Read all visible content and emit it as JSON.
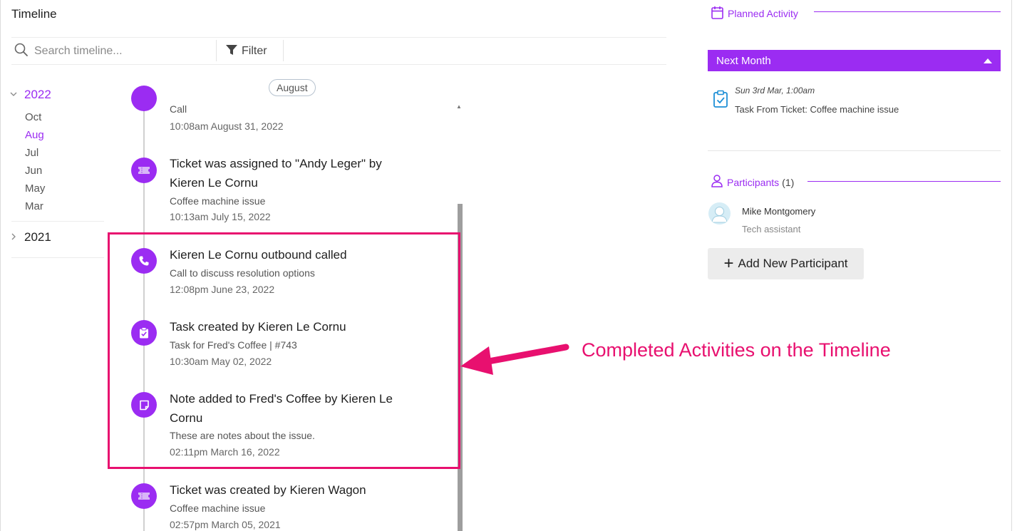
{
  "timeline": {
    "title": "Timeline",
    "search_placeholder": "Search timeline...",
    "filter_label": "Filter",
    "month_pill": "August",
    "years": [
      {
        "label": "2022",
        "expanded": true,
        "months": [
          "Oct",
          "Aug",
          "Jul",
          "Jun",
          "May",
          "Mar"
        ],
        "active_month": "Aug"
      },
      {
        "label": "2021",
        "expanded": false
      }
    ],
    "events": [
      {
        "icon": "phone-icon",
        "title": "",
        "subtitle": "Call",
        "time": "10:08am August 31, 2022"
      },
      {
        "icon": "ticket-icon",
        "title": "Ticket was assigned to \"Andy Leger\" by Kieren Le Cornu",
        "subtitle": "Coffee machine issue",
        "time": "10:13am July 15, 2022"
      },
      {
        "icon": "phone-icon",
        "title": "Kieren Le Cornu outbound called",
        "subtitle": "Call to discuss resolution options",
        "time": "12:08pm June 23, 2022"
      },
      {
        "icon": "task-icon",
        "title": "Task created by Kieren Le Cornu",
        "subtitle": "Task for Fred's Coffee | #743",
        "time": "10:30am May 02, 2022"
      },
      {
        "icon": "note-icon",
        "title": "Note added to Fred's Coffee by Kieren Le Cornu",
        "subtitle": "These are notes about the issue.",
        "time": "02:11pm March 16, 2022"
      },
      {
        "icon": "ticket-icon",
        "title": "Ticket was created by Kieren Wagon",
        "subtitle": "Coffee machine issue",
        "time": "02:57pm March 05, 2021"
      }
    ]
  },
  "annotation": {
    "text": "Completed Activities on the Timeline",
    "color": "#e8106f"
  },
  "planned_activity": {
    "heading": "Planned Activity",
    "group_label": "Next Month",
    "items": [
      {
        "icon": "clipboard-check-icon",
        "date": "Sun 3rd Mar, 1:00am",
        "title": "Task From Ticket: Coffee machine issue"
      }
    ]
  },
  "participants": {
    "heading": "Participants",
    "count": "(1)",
    "list": [
      {
        "name": "Mike Montgomery",
        "role": "Tech assistant"
      }
    ],
    "add_button_label": "Add New Participant"
  },
  "colors": {
    "accent": "#9b2cf2",
    "highlight": "#e8106f"
  }
}
